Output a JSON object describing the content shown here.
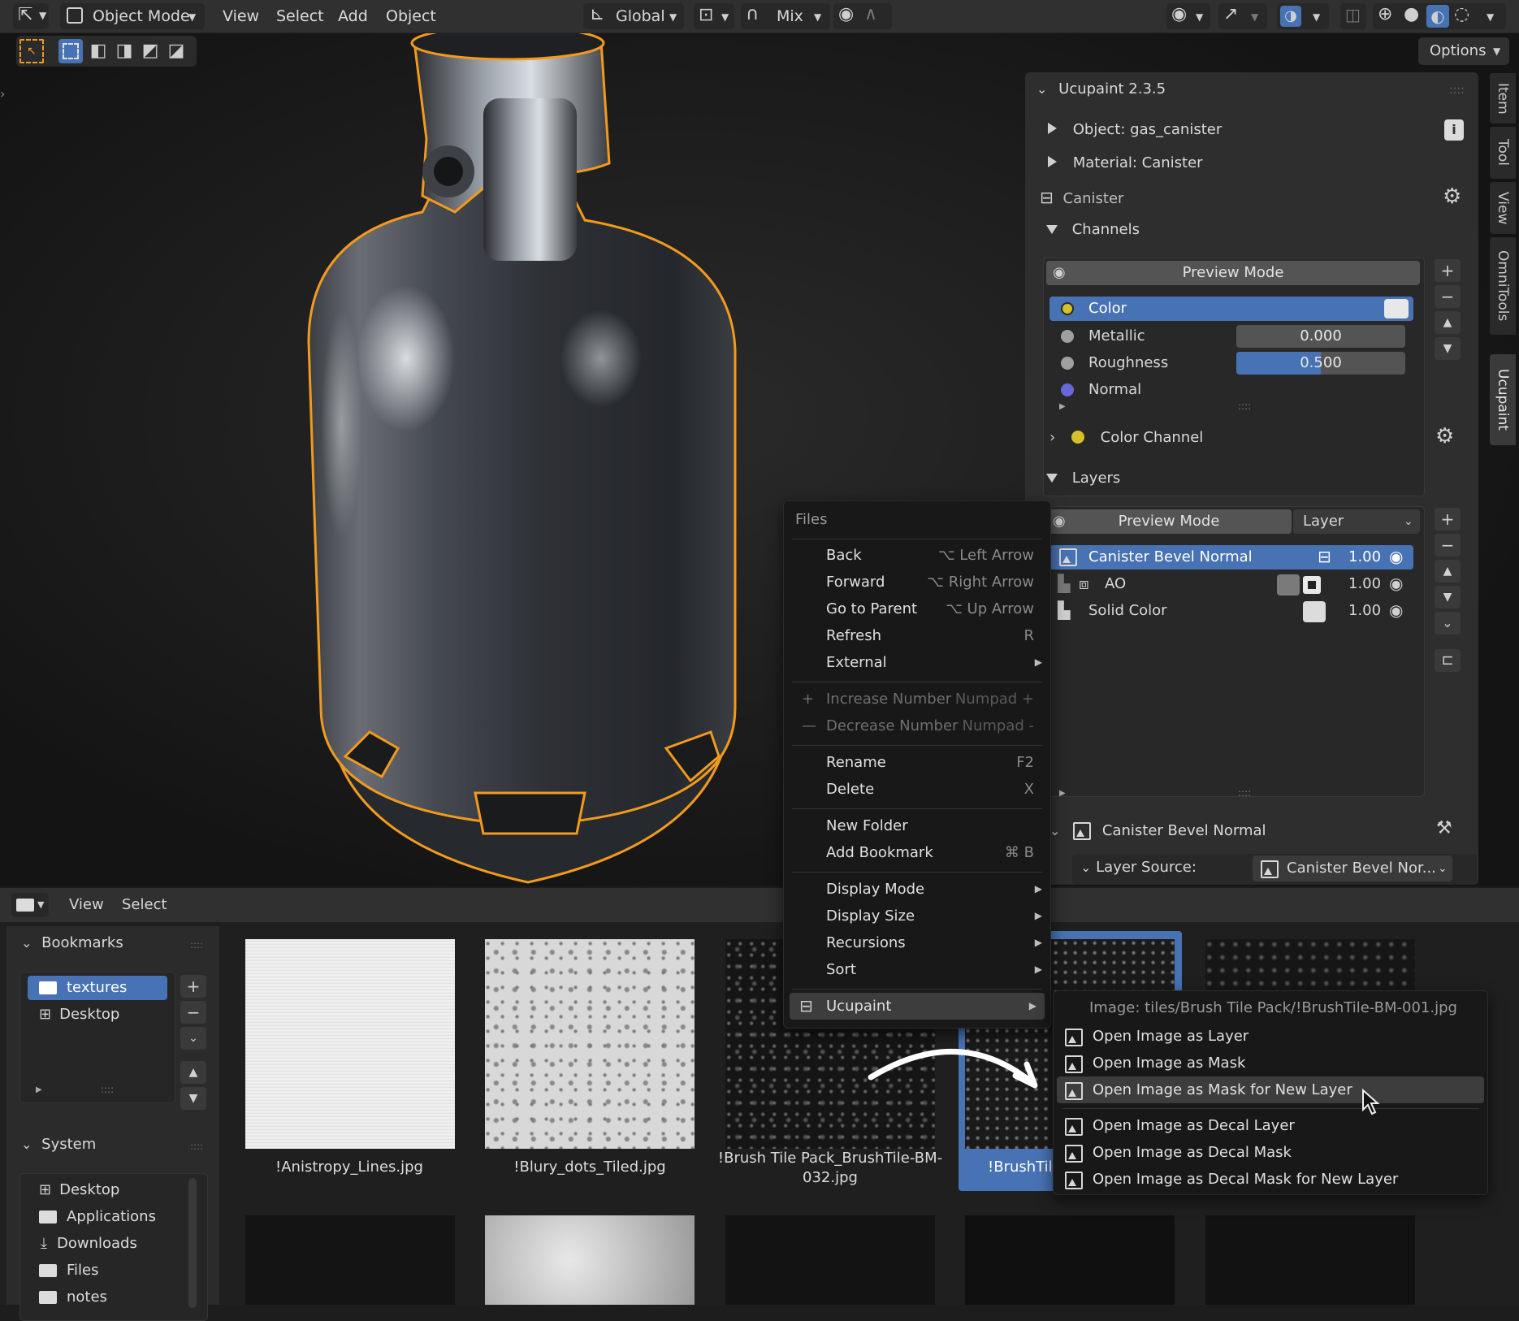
{
  "topbar": {
    "mode": "Object Mode",
    "menus": [
      "View",
      "Select",
      "Add",
      "Object"
    ],
    "orientation": "Global",
    "snap_mode": "Mix",
    "options": "Options"
  },
  "npanel": {
    "title": "Ucupaint 2.3.5",
    "object": "Object: gas_canister",
    "material": "Material: Canister",
    "tree": "Canister",
    "channels_header": "Channels",
    "channels_preview": "Preview Mode",
    "channels": [
      {
        "name": "Color",
        "color": "#d6c12a",
        "value": ""
      },
      {
        "name": "Metallic",
        "color": "#a0a0a0",
        "value": "0.000"
      },
      {
        "name": "Roughness",
        "color": "#a0a0a0",
        "value": "0.500"
      },
      {
        "name": "Normal",
        "color": "#6868d8",
        "value": ""
      }
    ],
    "color_channel": "Color Channel",
    "layers_header": "Layers",
    "layers_preview": "Preview Mode",
    "layers_dropdown": "Layer",
    "layers": [
      {
        "name": "Canister Bevel Normal",
        "value": "1.00"
      },
      {
        "name": "AO",
        "value": "1.00"
      },
      {
        "name": "Solid Color",
        "value": "1.00"
      }
    ],
    "layer_detail": "Canister Bevel Normal",
    "layer_source_label": "Layer Source:",
    "layer_source_value": "Canister Bevel Nor..."
  },
  "tabs": [
    "Item",
    "Tool",
    "View",
    "OmniTools",
    "Ucupaint"
  ],
  "filebrowser": {
    "menus": [
      "View",
      "Select"
    ],
    "bookmarks_header": "Bookmarks",
    "bookmarks": [
      "textures",
      "Desktop"
    ],
    "system_header": "System",
    "system": [
      "Desktop",
      "Applications",
      "Downloads",
      "Files",
      "notes"
    ],
    "files": [
      "!Anistropy_Lines.jpg",
      "!Blury_dots_Tiled.jpg",
      "!Brush Tile Pack_BrushTile-BM-032.jpg",
      "!BrushTil"
    ]
  },
  "files_menu": {
    "title": "Files",
    "items": [
      {
        "label": "Back",
        "shortcut": "⌥ Left Arrow"
      },
      {
        "label": "Forward",
        "shortcut": "⌥ Right Arrow"
      },
      {
        "label": "Go to Parent",
        "shortcut": "⌥ Up Arrow"
      },
      {
        "label": "Refresh",
        "shortcut": "R"
      },
      {
        "label": "External",
        "shortcut": ""
      },
      {
        "label": "Increase Number",
        "shortcut": "Numpad +"
      },
      {
        "label": "Decrease Number",
        "shortcut": "Numpad -"
      },
      {
        "label": "Rename",
        "shortcut": "F2"
      },
      {
        "label": "Delete",
        "shortcut": "X"
      },
      {
        "label": "New Folder",
        "shortcut": ""
      },
      {
        "label": "Add Bookmark",
        "shortcut": "⌘ B"
      },
      {
        "label": "Display Mode",
        "shortcut": ""
      },
      {
        "label": "Display Size",
        "shortcut": ""
      },
      {
        "label": "Recursions",
        "shortcut": ""
      },
      {
        "label": "Sort",
        "shortcut": ""
      },
      {
        "label": "Ucupaint",
        "shortcut": ""
      }
    ]
  },
  "ucupaint_menu": {
    "title": "Image: tiles/Brush Tile Pack/!BrushTile-BM-001.jpg",
    "items": [
      "Open Image as Layer",
      "Open Image as Mask",
      "Open Image as Mask for New Layer",
      "Open Image as Decal Layer",
      "Open Image as Decal Mask",
      "Open Image as Decal Mask for New Layer"
    ]
  }
}
